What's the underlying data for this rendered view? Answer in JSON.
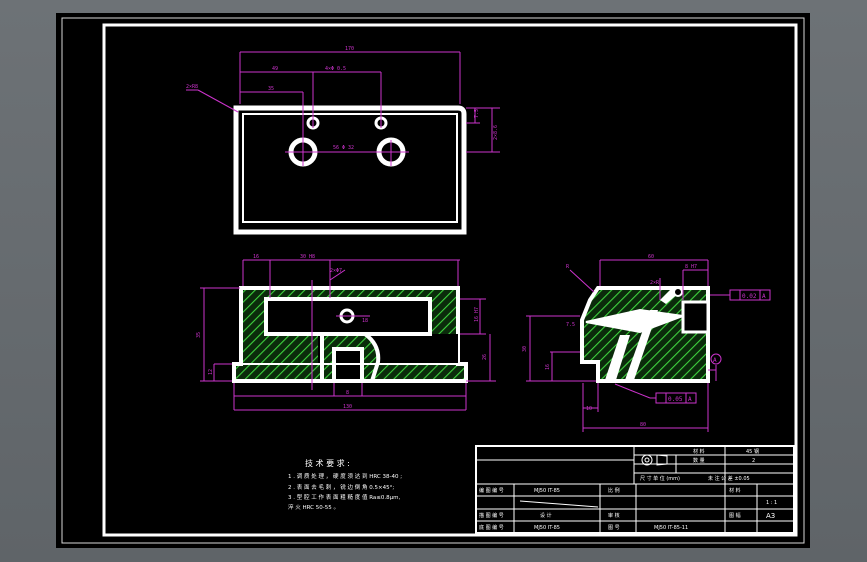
{
  "drawing": {
    "tech_title": "技 术 要 求 :",
    "tech_req": [
      "1 .  调 质 处 理 ， 硬 度 须 达 到 HRC 38-40 ;",
      "2 .  表 面 去 毛 刺 ， 锐 边 倒 角 0.5×45°;",
      "3 .  型 腔 工 作 表 面 粗 糙 度 值 Ra≤0.8μm,",
      "    淬 火 HRC 50-55 。"
    ]
  },
  "title_block": {
    "material_label": "材 料",
    "material_value": "45 钢",
    "qty_label": "数 量",
    "qty_value": "2",
    "unit_note": "尺 寸 单 位 (mm)",
    "tol_note": "未 注 公 差 ±0.05",
    "r1_label": "编 图 编 号",
    "r1_value": "MJ50 IT-85",
    "r1_mid": "比 例",
    "r2_label": "材 料",
    "r2_value": "1 : 1",
    "r3_label": "描 图 编 号",
    "r3_value": "设 计",
    "r3_mid": "审 核",
    "r3_right": "图 幅",
    "r3_right_value": "A3",
    "r4_label": "底 图 编 号",
    "r4_value": "MJ50 IT-85",
    "r4_mid": "图 号",
    "r4_code": "MJ50 IT-85-11"
  },
  "dims": {
    "top_total": "170",
    "top_a": "49",
    "top_b": "4×Φ 0.5",
    "top_c": "35",
    "top_r": "2×R8",
    "top_d": "56 Φ 32",
    "top_e": "7.5",
    "top_f": "2×8.6",
    "front_a": "16",
    "front_b": "30 H8",
    "front_c": "2×Φ7",
    "front_d": "35",
    "front_e": "26",
    "front_f": "8",
    "front_g": "12",
    "front_h": "18",
    "front_total": "130",
    "front_i": "16 H7",
    "side_a": "60",
    "side_b": "2×R",
    "side_c": "8 H7",
    "side_d": "30",
    "side_e": "7.5",
    "side_f": "16",
    "side_g": "10",
    "side_total": "80",
    "side_r": "R",
    "tol1": "0.02",
    "tol2": "0.05",
    "datum": "A"
  },
  "colors": {
    "accent_magenta": "#cc33cc",
    "outline_white": "#ffffff",
    "hatch_green": "#39c239"
  }
}
